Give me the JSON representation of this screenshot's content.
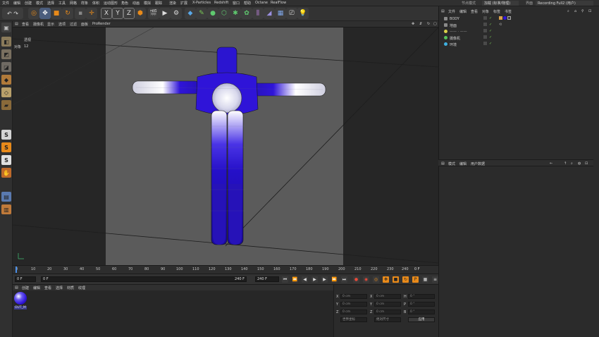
{
  "menubar": {
    "items": [
      "文件",
      "编辑",
      "创建",
      "模式",
      "选择",
      "工具",
      "网格",
      "样条",
      "体积",
      "运动图形",
      "角色",
      "动画",
      "模拟",
      "跟踪",
      "渲染",
      "扩展",
      "X-Particles",
      "Redshift",
      "窗口",
      "帮助",
      "Octane",
      "RealFlow"
    ],
    "right": {
      "node_mode_label": "节点模式",
      "node_value": "加载 (标准/物理)",
      "layout_label": "界面",
      "layout_value": "Recording Full2 (用户)"
    }
  },
  "toolbar": {
    "axis_labels": [
      "X",
      "Y",
      "Z"
    ]
  },
  "viewport": {
    "menu": [
      "查看",
      "摄像机",
      "显示",
      "选项",
      "过滤",
      "面板",
      "ProRender"
    ],
    "hud": {
      "title": "透视",
      "count_label": "对象",
      "count_value": "12"
    }
  },
  "timeline": {
    "ticks": [
      "0",
      "10",
      "20",
      "30",
      "40",
      "50",
      "60",
      "70",
      "80",
      "90",
      "100",
      "110",
      "120",
      "130",
      "140",
      "150",
      "160",
      "170",
      "180",
      "190",
      "200",
      "210",
      "220",
      "230",
      "240"
    ],
    "current_frame_readout": "0 F"
  },
  "transport": {
    "start_field": "0 F",
    "current_field": "0 F",
    "end_field": "240 F",
    "end_field_2": "240 F"
  },
  "material_manager": {
    "menu": [
      "创建",
      "编辑",
      "查看",
      "选择",
      "材质",
      "纹理"
    ],
    "material_name": "OUT_M"
  },
  "coordinates": {
    "rows": [
      {
        "a_label": "X",
        "a_value": "0 cm",
        "b_label": "X",
        "b_value": "0 cm",
        "c_label": "H",
        "c_value": "0 °"
      },
      {
        "a_label": "Y",
        "a_value": "0 cm",
        "b_label": "Y",
        "b_value": "0 cm",
        "c_label": "P",
        "c_value": "0 °"
      },
      {
        "a_label": "Z",
        "a_value": "0 cm",
        "b_label": "Z",
        "b_value": "0 cm",
        "c_label": "B",
        "c_value": "0 °"
      }
    ],
    "mode_dropdown": "世界坐标",
    "size_dropdown": "绝对尺寸",
    "apply_button": "应用"
  },
  "object_manager": {
    "tabs": [
      "文件",
      "编辑",
      "查看",
      "对象",
      "标签",
      "书签"
    ],
    "objects": [
      {
        "name": "BODY",
        "color": "#8a8a8a"
      },
      {
        "name": "地面",
        "color": "#8a8a8a"
      },
      {
        "name": "—— · ——",
        "color": "#d9d24a"
      },
      {
        "name": "摄像机",
        "color": "#56c35a"
      },
      {
        "name": "环境",
        "color": "#3fb0e0"
      }
    ]
  },
  "attribute_manager": {
    "tabs": [
      "模式",
      "编辑",
      "用户数据"
    ]
  },
  "colors": {
    "accent_blue": "#2f14d8",
    "highlight_orange": "#e88a1a"
  }
}
